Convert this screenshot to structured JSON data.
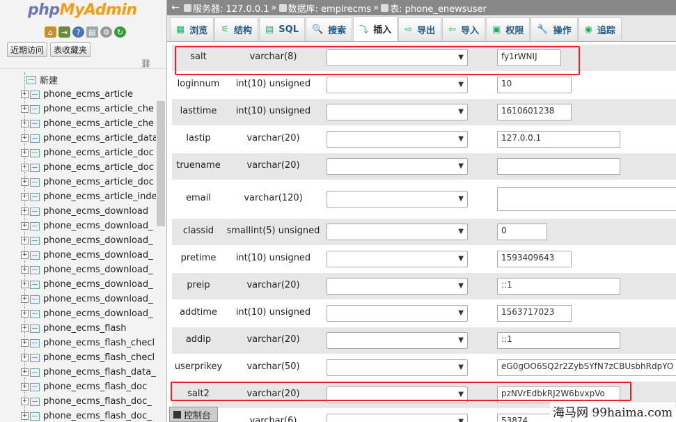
{
  "nav": {
    "logo": {
      "php": "php",
      "my": "My",
      "admin": "Admin"
    },
    "icons": [
      "home-icon",
      "exit-icon",
      "help-icon",
      "docs-icon",
      "settings-icon",
      "reload-icon"
    ],
    "tabs": [
      "近期访问",
      "表收藏夹"
    ],
    "new_label": "新建",
    "tables": [
      "phone_ecms_article",
      "phone_ecms_article_che",
      "phone_ecms_article_che",
      "phone_ecms_article_data",
      "phone_ecms_article_doc",
      "phone_ecms_article_doc",
      "phone_ecms_article_doc",
      "phone_ecms_article_inde",
      "phone_ecms_download",
      "phone_ecms_download_",
      "phone_ecms_download_",
      "phone_ecms_download_",
      "phone_ecms_download_",
      "phone_ecms_download_",
      "phone_ecms_download_",
      "phone_ecms_download_",
      "phone_ecms_flash",
      "phone_ecms_flash_checl",
      "phone_ecms_flash_checl",
      "phone_ecms_flash_data_",
      "phone_ecms_flash_doc",
      "phone_ecms_flash_doc_",
      "phone_ecms_flash_doc_"
    ]
  },
  "breadcrumb": {
    "back": "←",
    "server": "服务器: 127.0.0.1",
    "database": "数据库: empirecms",
    "table": "表: phone_enewsuser",
    "sep": "»"
  },
  "tabs": [
    {
      "label": "浏览",
      "icon": "▦"
    },
    {
      "label": "结构",
      "icon": "⚟"
    },
    {
      "label": "SQL",
      "icon": "▤"
    },
    {
      "label": "搜索",
      "icon": "🔍"
    },
    {
      "label": "插入",
      "icon": "⤵"
    },
    {
      "label": "导出",
      "icon": "⇨"
    },
    {
      "label": "导入",
      "icon": "⇦"
    },
    {
      "label": "权限",
      "icon": "▣"
    },
    {
      "label": "操作",
      "icon": "🔧"
    },
    {
      "label": "追踪",
      "icon": "◉"
    }
  ],
  "fields": [
    {
      "name": "salt",
      "type": "varchar(8)",
      "value": "fy1rWNIJ"
    },
    {
      "name": "loginnum",
      "type": "int(10) unsigned",
      "value": "10"
    },
    {
      "name": "lasttime",
      "type": "int(10) unsigned",
      "value": "1610601238"
    },
    {
      "name": "lastip",
      "type": "varchar(20)",
      "value": "127.0.0.1"
    },
    {
      "name": "truename",
      "type": "varchar(20)",
      "value": ""
    },
    {
      "name": "email",
      "type": "varchar(120)",
      "value": ""
    },
    {
      "name": "classid",
      "type": "smallint(5) unsigned",
      "value": "0"
    },
    {
      "name": "pretime",
      "type": "int(10) unsigned",
      "value": "1593409643"
    },
    {
      "name": "preip",
      "type": "varchar(20)",
      "value": "::1"
    },
    {
      "name": "addtime",
      "type": "int(10) unsigned",
      "value": "1563717023"
    },
    {
      "name": "addip",
      "type": "varchar(20)",
      "value": "::1"
    },
    {
      "name": "userprikey",
      "type": "varchar(50)",
      "value": "eG0gOO6SQ2r2ZybSYfN7zCBUsbhRdpYO"
    },
    {
      "name": "salt2",
      "type": "varchar(20)",
      "value": "pzNVrEdbkRJ2W6bvxpVo"
    },
    {
      "name": "",
      "type": "varchar(6)",
      "value": "53874"
    }
  ],
  "console_label": "控制台",
  "watermark": "海马网 99haima.com",
  "colors": {
    "highlight": "#e8202a",
    "crumb_bg": "#888888",
    "row_alt": "#e7e7e7"
  }
}
